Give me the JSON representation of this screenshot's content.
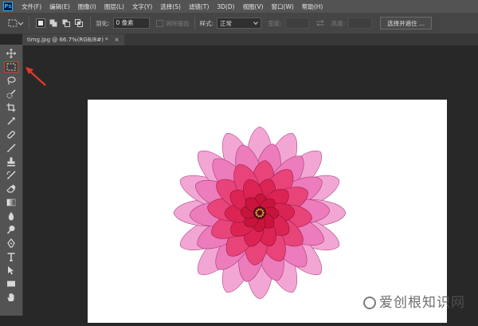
{
  "app": {
    "logo": "Ps"
  },
  "menu": [
    "文件(F)",
    "编辑(E)",
    "图像(I)",
    "图层(L)",
    "文字(Y)",
    "选择(S)",
    "滤镜(T)",
    "3D(D)",
    "视图(V)",
    "窗口(W)",
    "帮助(H)"
  ],
  "options": {
    "feather_label": "羽化:",
    "feather_value": "0 像素",
    "antialias_label": "消除锯齿",
    "style_label": "样式:",
    "style_value": "正常",
    "width_label": "宽度:",
    "height_label": "高度:",
    "select_mask_label": "选择并遮住 ..."
  },
  "document": {
    "tab_title": "timg.jpg @ 66.7%(RGB/8#) *",
    "close_glyph": "×"
  },
  "tools": [
    "move-tool",
    "rectangular-marquee-tool",
    "lasso-tool",
    "quick-selection-tool",
    "crop-tool",
    "eyedropper-tool",
    "healing-brush-tool",
    "brush-tool",
    "clone-stamp-tool",
    "history-brush-tool",
    "eraser-tool",
    "gradient-tool",
    "blur-tool",
    "dodge-tool",
    "pen-tool",
    "type-tool",
    "path-selection-tool",
    "rectangle-tool",
    "hand-tool"
  ],
  "selected_tool": "rectangular-marquee-tool",
  "colors": {
    "selection_outline": "#d63c2c",
    "annotation_arrow": "#e03a2a",
    "flower_center": "#d81e4a",
    "flower_edge": "#f3a8d6"
  },
  "watermark": {
    "text": "爱创根知识网"
  }
}
